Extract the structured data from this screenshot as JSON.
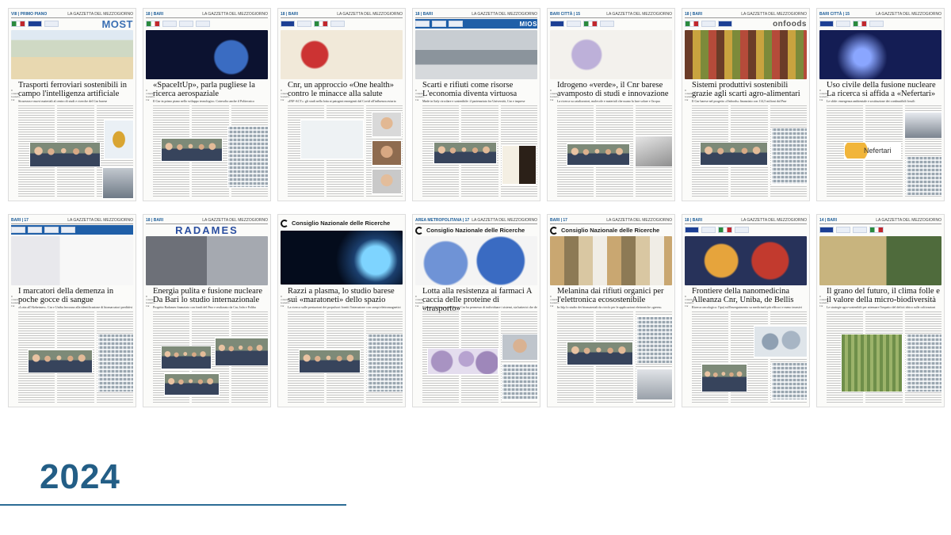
{
  "year_label": "2024",
  "pages_row1": [
    {
      "section": "VIII | PRIMO PIANO",
      "brand": "MOST",
      "headline": "Trasporti ferroviari sostenibili in campo l'intelligenza artificiale",
      "subline": "Sicurezza e nuovi materiali al centro di studi e ricerche del Cnr barese"
    },
    {
      "section": "18 | BARI",
      "brand": "",
      "headline": "«SpaceItUp», parla pugliese la ricerca aerospaziale",
      "subline": "Il Cnr in primo piano nello sviluppo tecnologico. Coinvolto anche il Politecnico"
    },
    {
      "section": "18 | BARI",
      "brand": "",
      "headline": "Cnr, un approccio «One health» contro le minacce alla salute",
      "subline": "«INF-ACT»: gli studi nella lotta ai patogeni emergenti dal Covid all'influenza aviaria"
    },
    {
      "section": "18 | BARI",
      "brand": "MIOS",
      "headline": "Scarti e rifiuti come risorse L'economia diventa virtuosa",
      "subline": "Made in Italy circolare e sostenibile: il partenariato fra Università, Cnr e imprese"
    },
    {
      "section": "BARI CITTÀ | 15",
      "brand": "",
      "headline": "Idrogeno «verde», il Cnr barese avamposto di studi e innovazione",
      "subline": "La ricerca su catalizzatori, molecole e materiali che usano la luce solare e l'acqua"
    },
    {
      "section": "18 | BARI",
      "brand": "onfoods",
      "headline": "Sistemi produttivi sostenibili grazie agli scarti agro-alimentari",
      "subline": "Il Cnr barese nel progetto «Onfoods» finanziato con 114,5 milioni dal Pnrr"
    },
    {
      "section": "BARI CITTÀ | 15",
      "brand": "",
      "headline": "Uso civile della fusione nucleare La ricerca si affida a «Nefertari»",
      "subline": "Le sfide: emergenza ambientale e sostituzione dei combustibili fossili"
    }
  ],
  "pages_row2": [
    {
      "section": "BARI | 17",
      "brand": "",
      "headline": "I marcatori della demenza in poche gocce di sangue",
      "subline": "«Lotta all'Alzheimer». Cnr e Uniba lavorano alla identificazione di biomarcatori predittivi"
    },
    {
      "section": "18 | BARI",
      "brand": "RADAMES",
      "headline": "Energia pulita e fusione nucleare Da Bari lo studio internazionale",
      "subline": "Progetto Radames finanziato con fondi del Pnrr e realizzato da Cnr, Infn e Poliba"
    },
    {
      "section": "",
      "brand": "Consiglio Nazionale delle Ricerche",
      "headline": "Razzi a plasma, lo studio barese sui «maratoneti» dello spazio",
      "subline": "La ricerca sulle prestazioni dei propulsori forniti l'interazione con campi elettromagnetici"
    },
    {
      "section": "AREA METROPOLITANA | 17",
      "brand": "Consiglio Nazionale delle Ricerche",
      "headline": "Lotta alla resistenza ai farmaci A caccia delle proteine di «trasporto»",
      "subline": "Il lavoro di ricerca dell'Ibiom-Cnr ha permesso di individuare i sistemi, sia batterici che delle cellule tumorali"
    },
    {
      "section": "BARI | 17",
      "brand": "Consiglio Nazionale delle Ricerche",
      "headline": "Melanina dai rifiuti organici per l'elettronica ecosostenibile",
      "subline": "In Islp lo studio dei biomateriali da riciclo per le applicazioni elettroniche «green»"
    },
    {
      "section": "18 | BARI",
      "brand": "",
      "headline": "Frontiere della nanomedicina Alleanza Cnr, Uniba, de Bellis",
      "subline": "Ricerca oncologica: l'ipa) sull'inserguimento su medicinali più efficaci e meno invasivi"
    },
    {
      "section": "14 | BARI",
      "brand": "",
      "headline": "Il grano del futuro, il clima folle e il valore della micro-biodiversità",
      "subline": "Le strategie agro-sostenibili per attenuare l'impatto del deficit idrico sulle coltivazioni"
    }
  ],
  "publication": "LA GAZZETTA DEL MEZZOGIORNO",
  "byline": "Il consulto Gazzetta-Cnr"
}
